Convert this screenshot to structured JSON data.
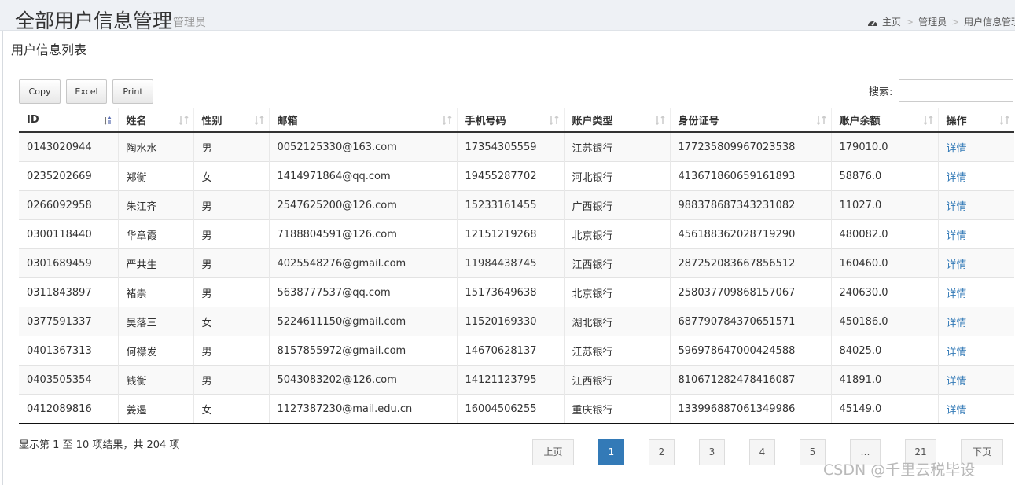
{
  "header": {
    "title": "全部用户信息管理",
    "subtitle": "管理员",
    "breadcrumb": [
      "主页",
      "管理员",
      "用户信息管理"
    ]
  },
  "section_title": "用户信息列表",
  "toolbar": {
    "copy_label": "Copy",
    "excel_label": "Excel",
    "print_label": "Print"
  },
  "search": {
    "label": "搜索:",
    "value": ""
  },
  "table": {
    "columns": [
      "ID",
      "姓名",
      "性别",
      "邮箱",
      "手机号码",
      "账户类型",
      "身份证号",
      "账户余额",
      "操作"
    ],
    "rows": [
      [
        "0143020944",
        "陶水水",
        "男",
        "0052125330@163.com",
        "17354305559",
        "江苏银行",
        "177235809967023538",
        "179010.0",
        "详情"
      ],
      [
        "0235202669",
        "郑衡",
        "女",
        "1414971864@qq.com",
        "19455287702",
        "河北银行",
        "413671860659161893",
        "58876.0",
        "详情"
      ],
      [
        "0266092958",
        "朱江齐",
        "男",
        "2547625200@126.com",
        "15233161455",
        "广西银行",
        "988378687343231082",
        "11027.0",
        "详情"
      ],
      [
        "0300118440",
        "华章霞",
        "男",
        "7188804591@126.com",
        "12151219268",
        "北京银行",
        "456188362028719290",
        "480082.0",
        "详情"
      ],
      [
        "0301689459",
        "严共生",
        "男",
        "4025548276@gmail.com",
        "11984438745",
        "江西银行",
        "287252083667856512",
        "160460.0",
        "详情"
      ],
      [
        "0311843897",
        "褚崇",
        "男",
        "5638777537@qq.com",
        "15173649638",
        "北京银行",
        "258037709868157067",
        "240630.0",
        "详情"
      ],
      [
        "0377591337",
        "吴落三",
        "女",
        "5224611150@gmail.com",
        "11520169330",
        "湖北银行",
        "687790784370651571",
        "450186.0",
        "详情"
      ],
      [
        "0401367313",
        "何襟发",
        "男",
        "8157855972@gmail.com",
        "14670628137",
        "江苏银行",
        "596978647000424588",
        "84025.0",
        "详情"
      ],
      [
        "0403505354",
        "钱衡",
        "男",
        "5043083202@126.com",
        "14121123795",
        "江西银行",
        "810671282478416087",
        "41891.0",
        "详情"
      ],
      [
        "0412089816",
        "姜遏",
        "女",
        "1127387230@mail.edu.cn",
        "16004506255",
        "重庆银行",
        "133996887061349986",
        "45149.0",
        "详情"
      ]
    ]
  },
  "info": "显示第 1 至 10 项结果，共 204 项",
  "pagination": {
    "prev": "上页",
    "pages": [
      "1",
      "2",
      "3",
      "4",
      "5",
      "…",
      "21"
    ],
    "next": "下页",
    "current": "1"
  },
  "watermark": "CSDN @千里云税毕设",
  "colors": {
    "accent": "#337ab7",
    "header_bg": "#eef1f5"
  }
}
